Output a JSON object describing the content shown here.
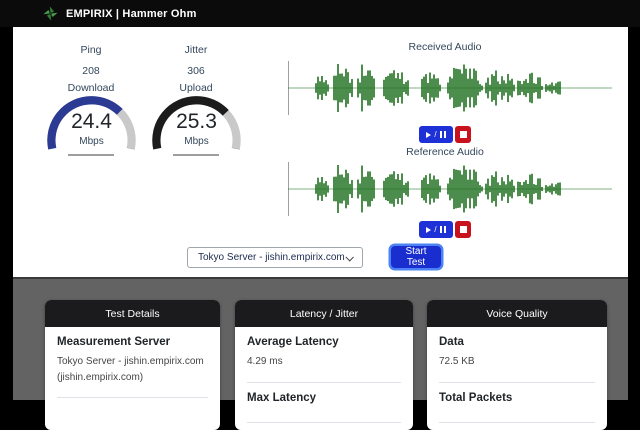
{
  "header": {
    "title": "EMPIRIX | Hammer Ohm"
  },
  "gauges": {
    "ping": {
      "label": "Ping",
      "value": "208"
    },
    "jitter": {
      "label": "Jitter",
      "value": "306"
    },
    "download": {
      "label": "Download",
      "value": "24.4",
      "unit": "Mbps",
      "fill_pct": 72,
      "color": "#2b3a93"
    },
    "upload": {
      "label": "Upload",
      "value": "25.3",
      "unit": "Mbps",
      "fill_pct": 73,
      "color": "#1c1c1c"
    }
  },
  "audio": {
    "received_label": "Received Audio",
    "reference_label": "Reference Audio",
    "waveform_color": "#1f701f",
    "play_pause_separator": "/"
  },
  "controls": {
    "server_select_value": "Tokyo Server - jishin.empirix.com",
    "start_button_label": "Start Test"
  },
  "cards": [
    {
      "title": "Test Details",
      "items": [
        {
          "label": "Measurement Server",
          "value": "Tokyo Server - jishin.empirix.com (jishin.empirix.com)"
        }
      ]
    },
    {
      "title": "Latency / Jitter",
      "items": [
        {
          "label": "Average Latency",
          "value": "4.29 ms"
        },
        {
          "label": "Max Latency",
          "value": ""
        }
      ]
    },
    {
      "title": "Voice Quality",
      "items": [
        {
          "label": "Data",
          "value": "72.5 KB"
        },
        {
          "label": "Total Packets",
          "value": ""
        }
      ]
    }
  ]
}
